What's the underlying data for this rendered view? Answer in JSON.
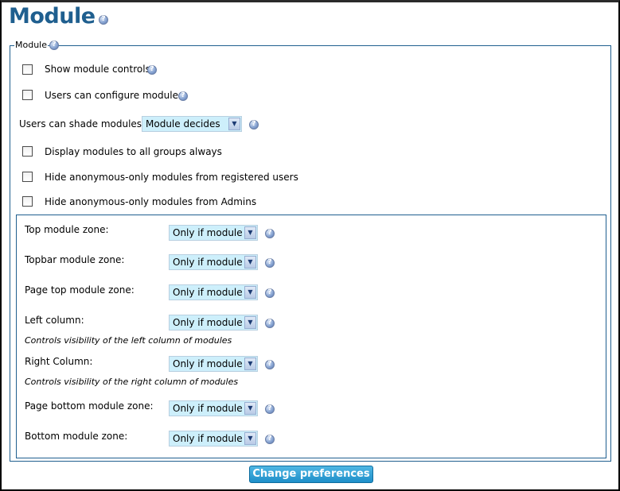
{
  "page": {
    "title": "Module"
  },
  "fieldset": {
    "legend": "Module"
  },
  "options": {
    "show_module_controls": {
      "label": "Show module controls",
      "checked": false
    },
    "users_can_configure": {
      "label": "Users can configure modules",
      "checked": false
    },
    "shade": {
      "label": "Users can shade modules:",
      "value": "Module decides"
    },
    "display_all_groups": {
      "label": "Display modules to all groups always",
      "checked": false
    },
    "hide_anon_registered": {
      "label": "Hide anonymous-only modules from registered users",
      "checked": false
    },
    "hide_anon_admins": {
      "label": "Hide anonymous-only modules from Admins",
      "checked": false
    }
  },
  "zones": [
    {
      "label": "Top module zone:",
      "value": "Only if module",
      "desc": ""
    },
    {
      "label": "Topbar module zone:",
      "value": "Only if module",
      "desc": ""
    },
    {
      "label": "Page top module zone:",
      "value": "Only if module",
      "desc": ""
    },
    {
      "label": "Left column:",
      "value": "Only if module",
      "desc": "Controls visibility of the left column of modules"
    },
    {
      "label": "Right Column:",
      "value": "Only if module",
      "desc": "Controls visibility of the right column of modules"
    },
    {
      "label": "Page bottom module zone:",
      "value": "Only if module",
      "desc": ""
    },
    {
      "label": "Bottom module zone:",
      "value": "Only if module",
      "desc": ""
    }
  ],
  "submit": {
    "label": "Change preferences"
  },
  "icons": {
    "help": "help-icon",
    "dropdown": "chevron-down-icon"
  },
  "colors": {
    "title": "#1f5f8f",
    "select_bg": "#cdeffb",
    "button": "#1e8fc9"
  }
}
